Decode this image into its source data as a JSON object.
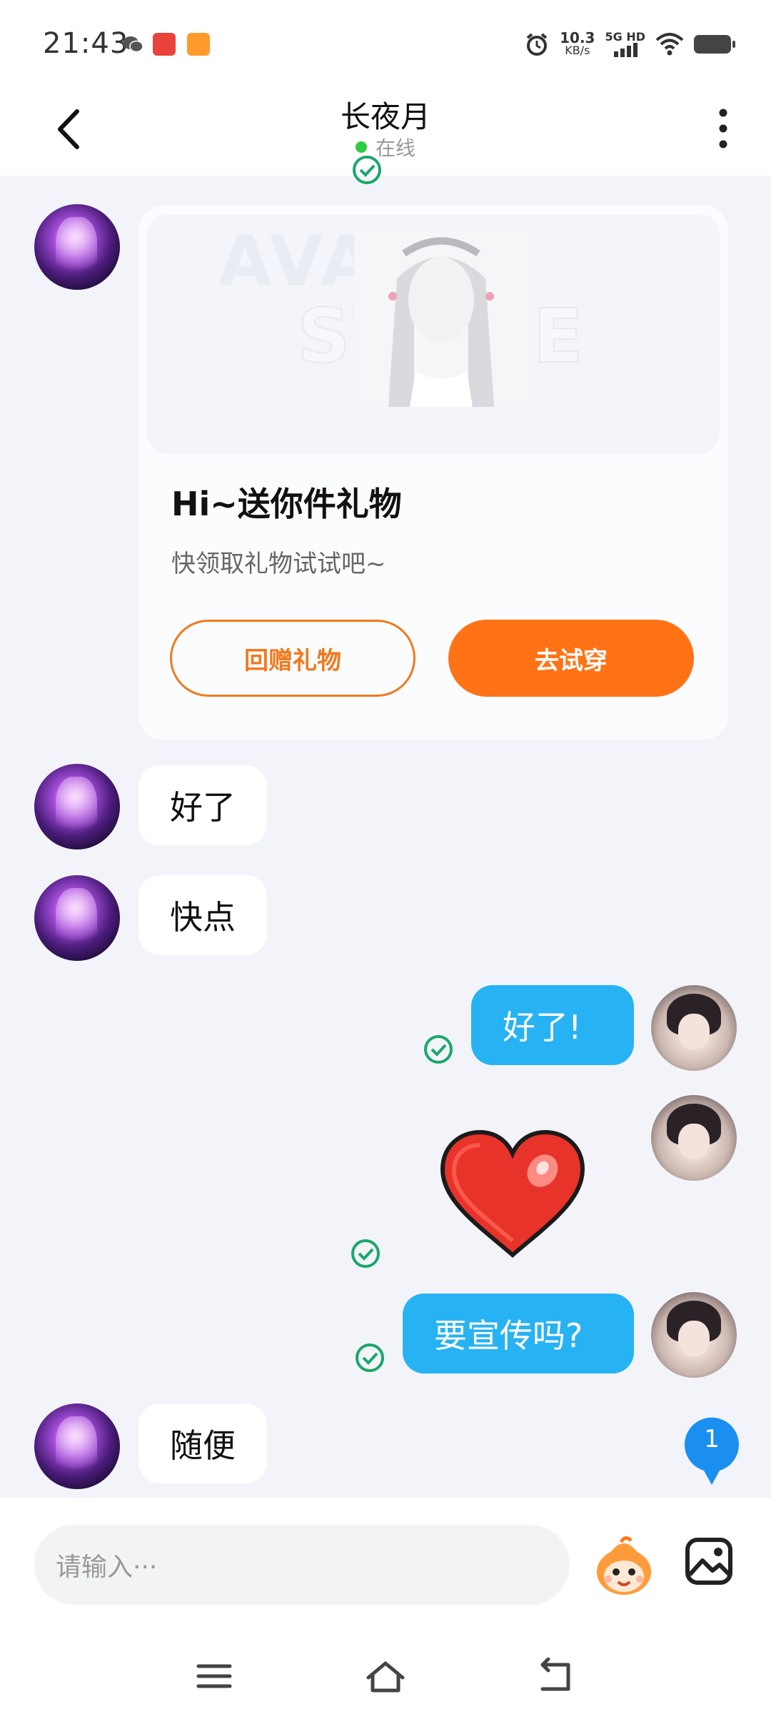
{
  "status_bar": {
    "time": "21:43",
    "net_speed_value": "10.3",
    "net_speed_unit": "KB/s",
    "signal_label": "5G HD",
    "icons": [
      "wechat-icon",
      "app-icon",
      "video-app-icon",
      "alarm-icon",
      "signal-icon",
      "wifi-icon",
      "battery-icon"
    ]
  },
  "header": {
    "title": "长夜月",
    "status": "在线",
    "status_color": "#2ecc40"
  },
  "gift_card": {
    "title": "Hi~送你件礼物",
    "subtitle": "快领取礼物试试吧~",
    "watermark_line1": "AVATAR",
    "watermark_line2": "STORE",
    "button_return": "回赠礼物",
    "button_try": "去试穿",
    "accent_color": "#ff7316"
  },
  "messages": [
    {
      "side": "in",
      "text": "好了"
    },
    {
      "side": "in",
      "text": "快点"
    },
    {
      "side": "out",
      "text": "好了!"
    },
    {
      "side": "out",
      "sticker": "heart-sticker"
    },
    {
      "side": "out",
      "text": "要宣传吗?"
    },
    {
      "side": "in",
      "text": "随便"
    }
  ],
  "unread_badge": "1",
  "input": {
    "placeholder": "请输入···"
  },
  "colors": {
    "outgoing_bubble": "#27b2f4",
    "incoming_bubble": "#ffffff",
    "read_tick": "#1aa76b",
    "chat_background": "#f2f4f9"
  }
}
